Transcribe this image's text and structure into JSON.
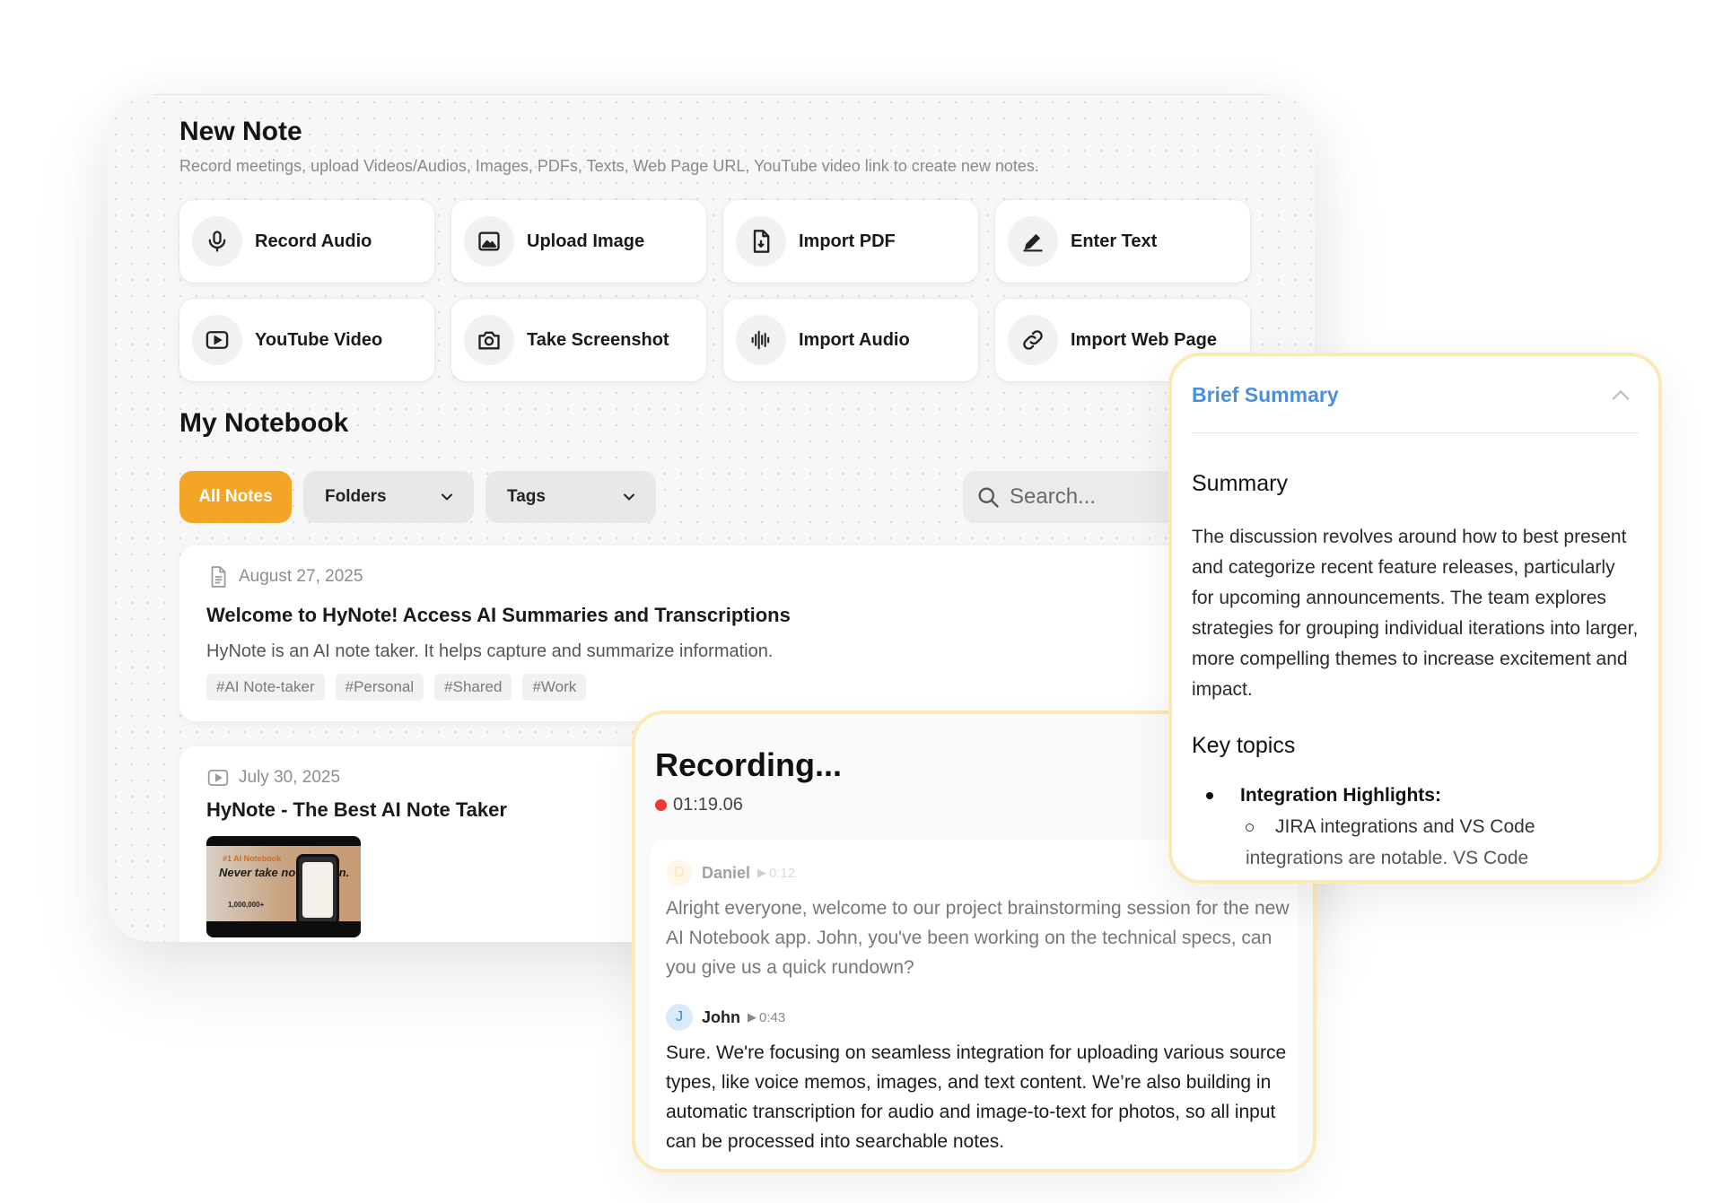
{
  "new_note": {
    "title": "New Note",
    "subtitle": "Record meetings, upload Videos/Audios, Images, PDFs, Texts, Web Page URL, YouTube video link to create new notes.",
    "actions": [
      {
        "label": "Record Audio",
        "icon": "microphone-icon"
      },
      {
        "label": "Upload Image",
        "icon": "image-icon"
      },
      {
        "label": "Import PDF",
        "icon": "file-pdf-icon"
      },
      {
        "label": "Enter Text",
        "icon": "pencil-icon"
      },
      {
        "label": "YouTube Video",
        "icon": "play-icon"
      },
      {
        "label": "Take Screenshot",
        "icon": "camera-icon"
      },
      {
        "label": "Import Audio",
        "icon": "waveform-icon"
      },
      {
        "label": "Import Web Page",
        "icon": "link-icon"
      }
    ]
  },
  "notebook": {
    "title": "My Notebook",
    "filter_all": "All Notes",
    "folders_label": "Folders",
    "tags_label": "Tags",
    "search_placeholder": "Search...",
    "notes": [
      {
        "date": "August 27, 2025",
        "title": "Welcome to HyNote! Access AI Summaries and Transcriptions",
        "description": "HyNote is an AI note taker. It helps capture and summarize information.",
        "tags": [
          "#AI Note-taker",
          "#Personal",
          "#Shared",
          "#Work"
        ]
      },
      {
        "date": "July 30, 2025",
        "title": "HyNote - The Best AI Note Taker",
        "thumbnail": {
          "badge": "#1 AI Notebook",
          "headline": "Never take notes again.",
          "stat": "1,000,000+"
        }
      }
    ]
  },
  "recording": {
    "title": "Recording...",
    "elapsed": "01:19.06",
    "status_color": "#ee3a33",
    "messages": [
      {
        "speaker": "Daniel",
        "initial": "D",
        "timestamp": "0:12",
        "text": "Alright everyone, welcome to our project brainstorming session for the new AI Notebook app. John, you've been working on the technical specs, can you give us a quick rundown?"
      },
      {
        "speaker": "John",
        "initial": "J",
        "timestamp": "0:43",
        "text": "Sure. We're focusing on seamless integration for uploading various source types, like voice memos, images, and text content. We’re also building in automatic transcription for audio and image-to-text for photos, so all input can be processed into searchable notes."
      }
    ]
  },
  "summary": {
    "header": "Brief Summary",
    "section_title": "Summary",
    "body": "The discussion revolves around how to best present and categorize recent feature releases, particularly for upcoming announcements. The team explores strategies for grouping individual iterations into larger, more compelling themes to increase excitement and impact.",
    "key_topics_title": "Key topics",
    "bullet": "Integration Highlights:",
    "sub_bullet": "JIRA integrations and VS Code",
    "sub_bullet_cont": "integrations are notable. VS Code"
  },
  "colors": {
    "accent": "#f3a626",
    "link_blue": "#4a8fdc",
    "panel_border": "#fbeab5"
  }
}
